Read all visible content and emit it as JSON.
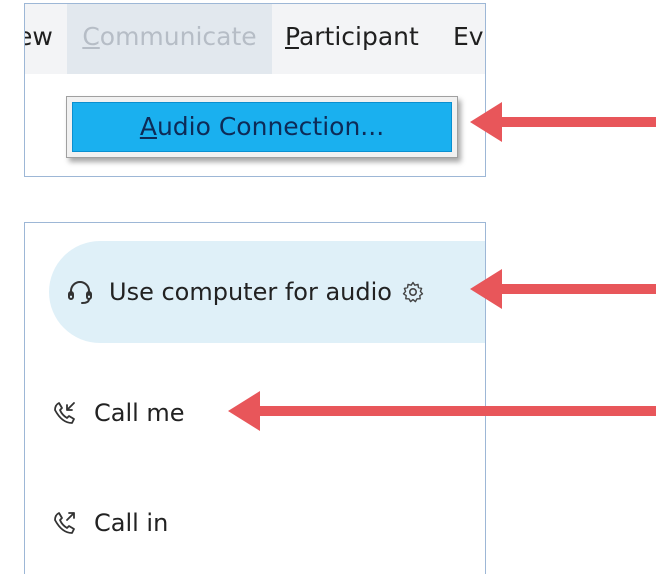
{
  "menubar": {
    "view_fragment": "ew",
    "communicate": {
      "first": "C",
      "rest": "ommunicate"
    },
    "participant": {
      "first": "P",
      "rest": "articipant"
    },
    "events_fragment": "Ev"
  },
  "dropdown": {
    "audio_connection": {
      "first": "A",
      "rest": "udio Connection..."
    }
  },
  "audio_options": [
    {
      "label": "Use computer for audio",
      "icon": "headset-icon",
      "selected": true
    },
    {
      "label": "Call me",
      "icon": "phone-incoming-icon",
      "selected": false
    },
    {
      "label": "Call in",
      "icon": "phone-outgoing-icon",
      "selected": false
    }
  ],
  "colors": {
    "arrow": "#e8565a",
    "highlight": "#1ab0ef",
    "selected_bg": "#dff0f8",
    "panel_border": "#9db7d6"
  }
}
